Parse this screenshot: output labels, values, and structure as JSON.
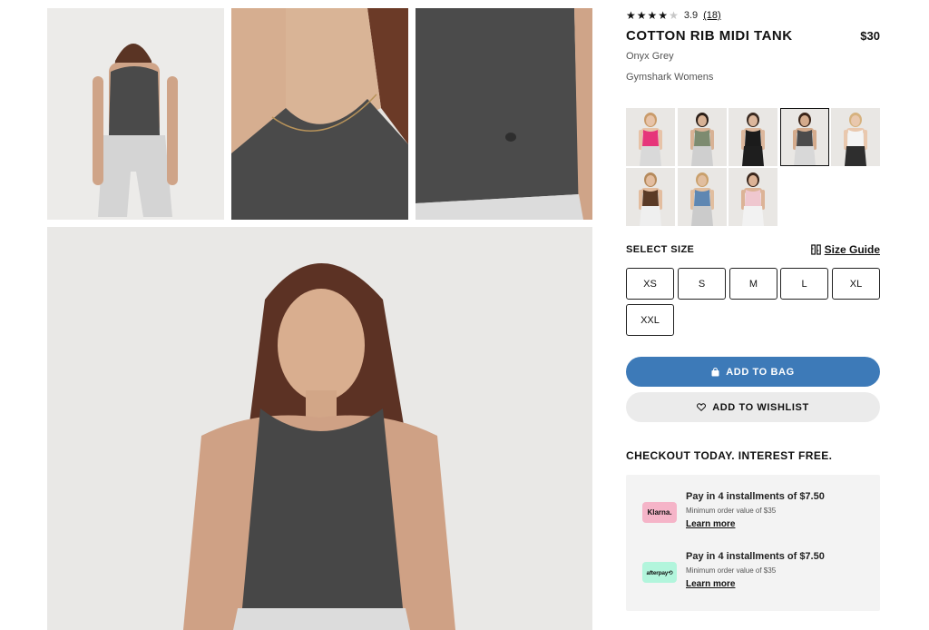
{
  "gallery": {
    "images": [
      {
        "label": "back-view",
        "alt": "Back view of model wearing tank"
      },
      {
        "label": "neckline-detail",
        "alt": "Neckline detail"
      },
      {
        "label": "hem-detail",
        "alt": "Hem and logo detail"
      },
      {
        "label": "front-view",
        "alt": "Front view of model wearing tank"
      }
    ]
  },
  "product": {
    "rating": {
      "stars": 4,
      "max": 5,
      "score": "3.9",
      "count": "(18)"
    },
    "title": "COTTON RIB MIDI TANK",
    "price": "$30",
    "color": "Onyx Grey",
    "collection": "Gymshark Womens"
  },
  "swatches": [
    {
      "name": "pink",
      "top": "#e6357a",
      "bottom": "#d9d9d9",
      "skin": "#e7c3a8",
      "hair": "#c99b6a"
    },
    {
      "name": "sage",
      "top": "#7d8b70",
      "bottom": "#cfcfcf",
      "skin": "#d8b295",
      "hair": "#2a1e17"
    },
    {
      "name": "black",
      "top": "#1b1b1b",
      "bottom": "#1e1e1e",
      "skin": "#dcb79c",
      "hair": "#3a2a20"
    },
    {
      "name": "onyx-grey",
      "top": "#4b4b4b",
      "bottom": "#d8d8d8",
      "skin": "#d4ab8c",
      "hair": "#3a2418",
      "selected": true
    },
    {
      "name": "white",
      "top": "#f4f4f4",
      "bottom": "#2e2e2e",
      "skin": "#e9c8ae",
      "hair": "#d6b27f"
    },
    {
      "name": "brown",
      "top": "#5a3a26",
      "bottom": "#efefef",
      "skin": "#e3bd9f",
      "hair": "#b58a5c"
    },
    {
      "name": "blue",
      "top": "#5f87b2",
      "bottom": "#cbcbcb",
      "skin": "#e1be9f",
      "hair": "#c9a06c"
    },
    {
      "name": "light-pink",
      "top": "#efc7cf",
      "bottom": "#f2f2f2",
      "skin": "#dcb396",
      "hair": "#3b271c"
    }
  ],
  "size": {
    "label": "SELECT SIZE",
    "guide": "Size Guide",
    "options": [
      "XS",
      "S",
      "M",
      "L",
      "XL",
      "XXL"
    ]
  },
  "actions": {
    "add_to_bag": "ADD TO BAG",
    "add_to_wishlist": "ADD TO WISHLIST"
  },
  "checkout": {
    "title": "CHECKOUT TODAY. INTEREST FREE.",
    "providers": [
      {
        "logo": "Klarna.",
        "main": "Pay in 4 installments of $7.50",
        "min": "Minimum order value of $35",
        "link": "Learn more"
      },
      {
        "logo": "afterpay⟲",
        "main": "Pay in 4 installments of $7.50",
        "min": "Minimum order value of $35",
        "link": "Learn more"
      }
    ]
  },
  "colors": {
    "accent": "#3d7ab8",
    "wishlist_bg": "#ebebeb",
    "pay_box_bg": "#f3f3f3",
    "klarna": "#f5b4c8",
    "afterpay": "#b2f5dc"
  }
}
